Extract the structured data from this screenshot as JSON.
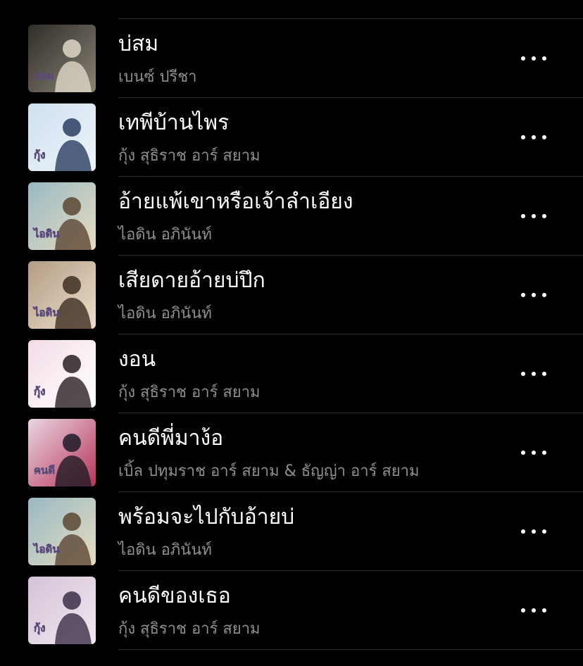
{
  "songs": [
    {
      "title": "บ่สม",
      "artist": "เบนซ์ ปรีชา",
      "artwork": {
        "caption": "บ่สม",
        "colors": [
          "#2f2d29",
          "#8a8375",
          "#ddd8c8"
        ]
      }
    },
    {
      "title": "เทพีบ้านไพร",
      "artist": "กุ้ง สุธิราช อาร์ สยาม",
      "artwork": {
        "caption": "กุ้ง",
        "colors": [
          "#cfe0ef",
          "#eef4f9",
          "#2b3e63"
        ]
      }
    },
    {
      "title": "อ้ายแพ้เขาหรือเจ้าลำเอียง",
      "artist": "ไอดิน อภินันท์",
      "artwork": {
        "caption": "ไอดิน",
        "colors": [
          "#98b9c3",
          "#e7dcc2",
          "#5c4633"
        ]
      }
    },
    {
      "title": "เสียดายอ้ายบ่ปึก",
      "artist": "ไอดิน อภินันท์",
      "artwork": {
        "caption": "ไอดิน",
        "colors": [
          "#b49c86",
          "#ecdfc9",
          "#3e2e22"
        ]
      }
    },
    {
      "title": "งอน",
      "artist": "กุ้ง สุธิราช อาร์ สยาม",
      "artwork": {
        "caption": "กุ้ง",
        "colors": [
          "#f3dde8",
          "#ffffff",
          "#2a2024"
        ]
      }
    },
    {
      "title": "คนดีพี่มาง้อ",
      "artist": "เบิ้ล ปทุมราช อาร์ สยาม & ธัญญ่า อาร์ สยาม",
      "artwork": {
        "caption": "คนดี",
        "colors": [
          "#e9d6e2",
          "#b7345a",
          "#1f1a24"
        ]
      }
    },
    {
      "title": "พร้อมจะไปกับอ้ายบ่",
      "artist": "ไอดิน อภินันท์",
      "artwork": {
        "caption": "ไอดิน",
        "colors": [
          "#98b9c3",
          "#e7dcc2",
          "#5c4633"
        ]
      }
    },
    {
      "title": "คนดีของเธอ",
      "artist": "กุ้ง สุธิราช อาร์ สยาม",
      "artwork": {
        "caption": "กุ้ง",
        "colors": [
          "#d4c2d7",
          "#f2e9f0",
          "#3b2f49"
        ]
      }
    }
  ],
  "more_icon": "ellipsis-icon"
}
